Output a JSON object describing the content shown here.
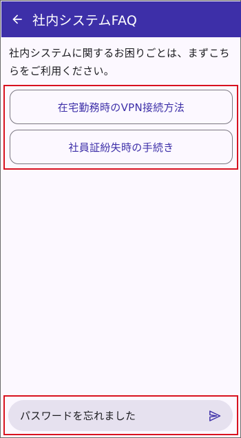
{
  "appbar": {
    "title": "社内システムFAQ",
    "back_icon": "arrow-left-icon",
    "color": "#3d2fa8"
  },
  "intro": {
    "text": "社内システムに関するお困りごとは、まずこちらをご利用ください。"
  },
  "faq": {
    "items": [
      {
        "label": "在宅勤務時のVPN接続方法"
      },
      {
        "label": "社員証紛失時の手続き"
      }
    ]
  },
  "composer": {
    "value": "パスワードを忘れました",
    "send_icon": "send-icon"
  },
  "highlight_color": "#d8121f"
}
